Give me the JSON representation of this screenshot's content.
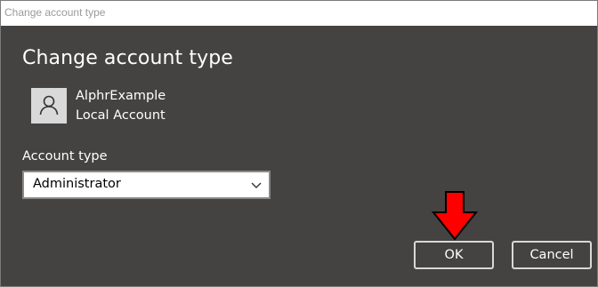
{
  "window": {
    "title": "Change account type"
  },
  "dialog": {
    "heading": "Change account type",
    "user": {
      "name": "AlphrExample",
      "account_kind": "Local Account",
      "avatar_icon": "person-icon"
    },
    "account_type": {
      "label": "Account type",
      "selected": "Administrator",
      "dropdown_icon": "chevron-down-icon"
    },
    "buttons": {
      "ok": "OK",
      "cancel": "Cancel"
    },
    "annotation": {
      "icon": "red-arrow-down-icon",
      "color": "#ff0000"
    }
  },
  "colors": {
    "dialog_background": "#454341",
    "text": "#ffffff",
    "titlebar_text": "#9a9a9a"
  }
}
